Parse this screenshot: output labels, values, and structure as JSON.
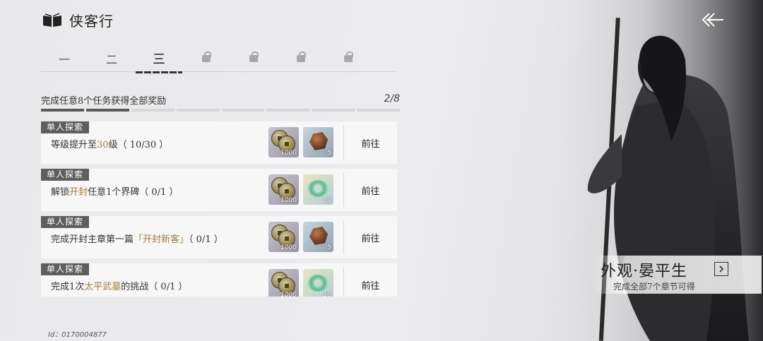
{
  "header": {
    "title": "侠客行"
  },
  "tabs": [
    {
      "label": "一",
      "locked": false
    },
    {
      "label": "二",
      "locked": false
    },
    {
      "label": "三",
      "locked": false,
      "active": true
    },
    {
      "label": "",
      "locked": true
    },
    {
      "label": "",
      "locked": true
    },
    {
      "label": "",
      "locked": true
    },
    {
      "label": "",
      "locked": true
    }
  ],
  "goal": {
    "text": "完成任意8个任务获得全部奖励",
    "count": "2/8",
    "completed": 2,
    "total": 8
  },
  "badge_label": "单人探索",
  "go_label": "前往",
  "tasks": [
    {
      "pre": "等级提升至",
      "hl": "30",
      "post": "级（ 10/30 ）",
      "rewards": [
        {
          "type": "coin",
          "qty": "1000"
        },
        {
          "type": "ore",
          "qty": "5"
        }
      ]
    },
    {
      "pre": "解锁",
      "hl": "开封",
      "post": "任意1个界碑（ 0/1 ）",
      "rewards": [
        {
          "type": "coin",
          "qty": "1000"
        },
        {
          "type": "jade",
          "qty": "10"
        }
      ]
    },
    {
      "pre": "完成开封主章第一篇",
      "hl": "「开封新客」",
      "post": "（ 0/1 ）",
      "rewards": [
        {
          "type": "coin",
          "qty": "1000"
        },
        {
          "type": "ore",
          "qty": "5"
        }
      ]
    },
    {
      "pre": "完成1次",
      "hl": "太平武墓",
      "post": "的挑战（ 0/1 ）",
      "rewards": [
        {
          "type": "coin",
          "qty": "1000"
        },
        {
          "type": "jade",
          "qty": "10"
        }
      ]
    }
  ],
  "uid": "Id：0170004877",
  "skin": {
    "name": "外观·晏平生",
    "subtitle": "完成全部7个章节可得"
  },
  "colors": {
    "highlight": "#a47a3a",
    "badge": "#5e5e5e"
  }
}
